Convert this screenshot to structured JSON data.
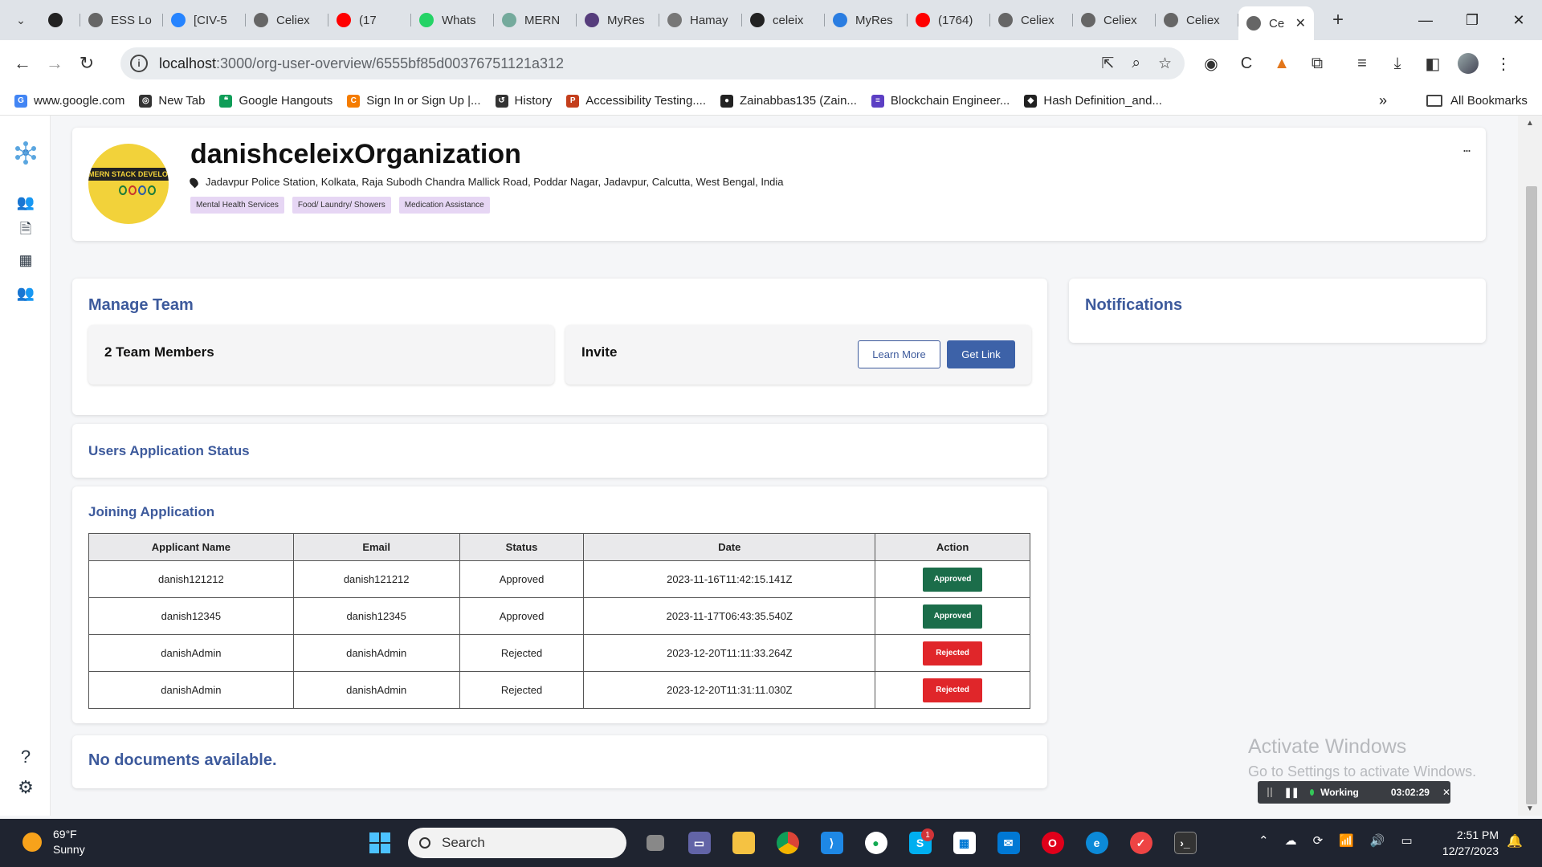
{
  "browser": {
    "tabs": [
      {
        "label": "",
        "icon": "github-icon",
        "color": "#222"
      },
      {
        "label": "ESS Lo",
        "icon": "globe-icon",
        "color": "#666"
      },
      {
        "label": "[CIV-5",
        "icon": "jira-icon",
        "color": "#2684ff"
      },
      {
        "label": "Celiex",
        "icon": "globe-icon",
        "color": "#666"
      },
      {
        "label": "(17",
        "icon": "youtube-icon",
        "color": "#ff0000"
      },
      {
        "label": "Whats",
        "icon": "whatsapp-icon",
        "color": "#25d366"
      },
      {
        "label": "MERN",
        "icon": "chatgpt-icon",
        "color": "#74aa9c"
      },
      {
        "label": "MyRes",
        "icon": "bootstrap-icon",
        "color": "#563d7c"
      },
      {
        "label": "Hamay",
        "icon": "hashnode-icon",
        "color": "#777"
      },
      {
        "label": "celeix",
        "icon": "github-icon",
        "color": "#222"
      },
      {
        "label": "MyRes",
        "icon": "flutter-icon",
        "color": "#2a7de1"
      },
      {
        "label": "(1764)",
        "icon": "youtube-icon",
        "color": "#ff0000"
      },
      {
        "label": "Celiex",
        "icon": "globe-icon",
        "color": "#666"
      },
      {
        "label": "Celiex",
        "icon": "globe-icon",
        "color": "#666"
      },
      {
        "label": "Celiex",
        "icon": "globe-icon",
        "color": "#666"
      },
      {
        "label": "Ce",
        "icon": "globe-icon",
        "color": "#666"
      }
    ],
    "url_host": "localhost",
    "url_path": ":3000/org-user-overview/6555bf85d00376751121a312",
    "bookmarks": [
      {
        "label": "www.google.com",
        "icon": "google-icon",
        "color": "#4285f4",
        "glyph": "G"
      },
      {
        "label": "New Tab",
        "icon": "globe-icon",
        "color": "#333",
        "glyph": "◎"
      },
      {
        "label": "Google Hangouts",
        "icon": "hangouts-icon",
        "color": "#0f9d58",
        "glyph": "❝"
      },
      {
        "label": "Sign In or Sign Up |...",
        "icon": "c-icon",
        "color": "#f57c00",
        "glyph": "C"
      },
      {
        "label": "History",
        "icon": "history-icon",
        "color": "#333",
        "glyph": "↺"
      },
      {
        "label": "Accessibility Testing....",
        "icon": "powerpoint-icon",
        "color": "#c43e1c",
        "glyph": "P"
      },
      {
        "label": "Zainabbas135 (Zain...",
        "icon": "github-icon",
        "color": "#222",
        "glyph": "●"
      },
      {
        "label": "Blockchain Engineer...",
        "icon": "list-icon",
        "color": "#5c3fc4",
        "glyph": "≡"
      },
      {
        "label": "Hash Definition_and...",
        "icon": "hash-icon",
        "color": "#222",
        "glyph": "◆"
      }
    ],
    "all_bookmarks": "All Bookmarks"
  },
  "org": {
    "name": "danishceleixOrganization",
    "address": "Jadavpur Police Station, Kolkata, Raja Subodh Chandra Mallick Road, Poddar Nagar, Jadavpur, Calcutta, West Bengal, India",
    "logo_text": "MERN STACK DEVELOPER",
    "tags": [
      "Mental Health Services",
      "Food/ Laundry/ Showers",
      "Medication Assistance"
    ],
    "more": "..."
  },
  "manage_team": {
    "title": "Manage Team",
    "members": "2 Team Members",
    "invite": "Invite",
    "learn_more": "Learn More",
    "get_link": "Get Link"
  },
  "notifications": {
    "title": "Notifications"
  },
  "users_status": {
    "title": "Users Application Status"
  },
  "joining": {
    "title": "Joining Application",
    "columns": [
      "Applicant Name",
      "Email",
      "Status",
      "Date",
      "Action"
    ],
    "rows": [
      {
        "name": "danish121212",
        "email": "danish121212",
        "status": "Approved",
        "date": "2023-11-16T11:42:15.141Z",
        "action": "Approved"
      },
      {
        "name": "danish12345",
        "email": "danish12345",
        "status": "Approved",
        "date": "2023-11-17T06:43:35.540Z",
        "action": "Approved"
      },
      {
        "name": "danishAdmin",
        "email": "danishAdmin",
        "status": "Rejected",
        "date": "2023-12-20T11:11:33.264Z",
        "action": "Rejected"
      },
      {
        "name": "danishAdmin",
        "email": "danishAdmin",
        "status": "Rejected",
        "date": "2023-12-20T11:31:11.030Z",
        "action": "Rejected"
      }
    ]
  },
  "documents": {
    "message": "No documents available."
  },
  "overlay": {
    "activate_title": "Activate Windows",
    "activate_sub": "Go to Settings to activate Windows.",
    "timer_status": "Working",
    "timer_time": "03:02:29"
  },
  "taskbar": {
    "temp": "69°F",
    "condition": "Sunny",
    "search_placeholder": "Search",
    "time": "2:51 PM",
    "date": "12/27/2023"
  },
  "colors": {
    "accent": "#3d5a9c",
    "approved": "#1b6d4a",
    "rejected": "#e0262a",
    "tag_bg": "#e6d6f4"
  }
}
